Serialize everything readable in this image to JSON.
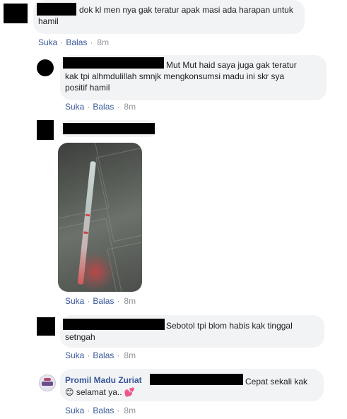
{
  "comments": [
    {
      "text_lines": [
        "dok kl men nya gak teratur apak masi ada harapan untuk",
        "hamil"
      ],
      "actions": {
        "like": "Suka",
        "reply": "Balas",
        "time": "8m"
      }
    },
    {
      "text_lines": [
        "Mut Mut haid saya juga gak teratur",
        "kak tpi alhmdulillah smnjk mengkonsumsi madu ini skr sya",
        "positif hamil"
      ],
      "actions": {
        "like": "Suka",
        "reply": "Balas",
        "time": "8m"
      }
    },
    {
      "actions": {
        "like": "Suka",
        "reply": "Balas",
        "time": "8m"
      }
    },
    {
      "text_lines": [
        "Sebotol tpi blom habis kak tinggal",
        "setngah"
      ],
      "actions": {
        "like": "Suka",
        "reply": "Balas",
        "time": "8m"
      }
    },
    {
      "author": "Promil Madu Zuriat",
      "text_lines": [
        "Cepat sekali kak",
        "selamat ya.."
      ],
      "emoji_smile": "😊",
      "emoji_heart": "💕",
      "actions": {
        "like": "Suka",
        "reply": "Balas",
        "time": "8m"
      }
    }
  ]
}
